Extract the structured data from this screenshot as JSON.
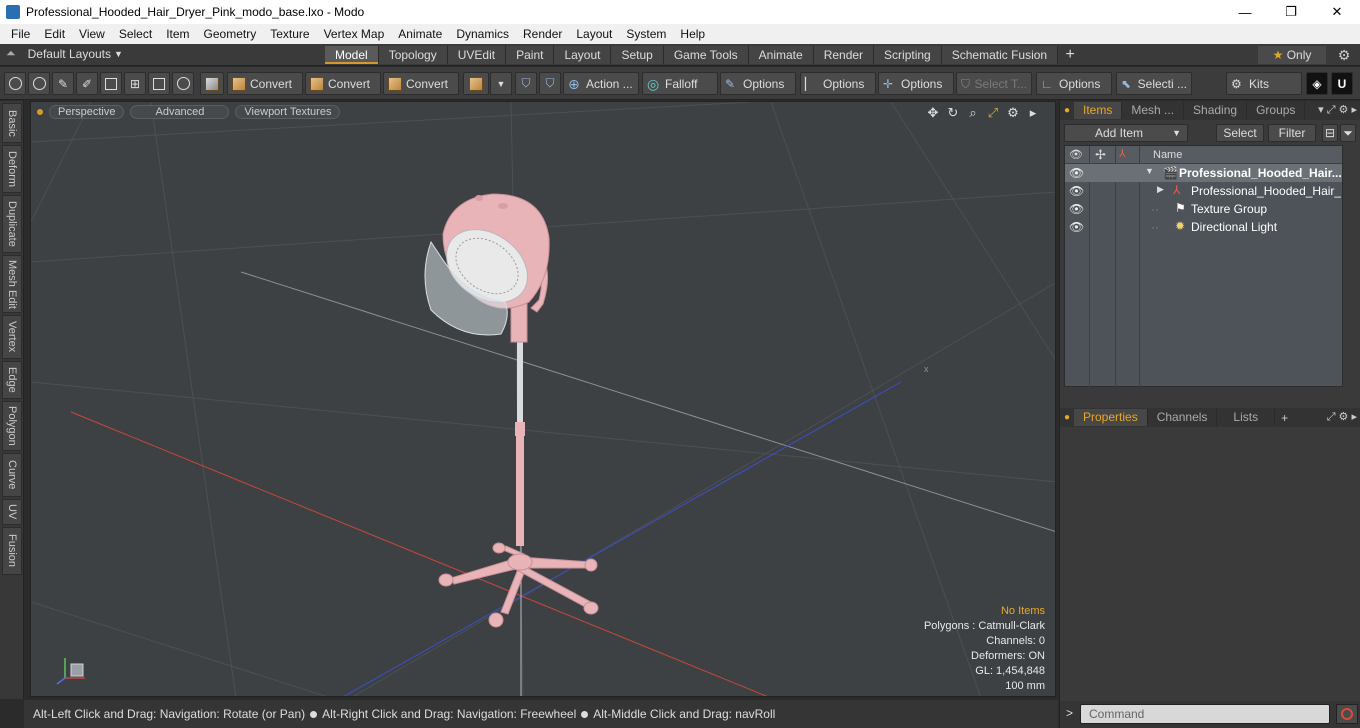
{
  "window": {
    "title": "Professional_Hooded_Hair_Dryer_Pink_modo_base.lxo - Modo",
    "controls": [
      "—",
      "❐",
      "✕"
    ]
  },
  "menu": [
    "File",
    "Edit",
    "View",
    "Select",
    "Item",
    "Geometry",
    "Texture",
    "Vertex Map",
    "Animate",
    "Dynamics",
    "Render",
    "Layout",
    "System",
    "Help"
  ],
  "layouts": {
    "label": "Default Layouts"
  },
  "tabs": [
    "Model",
    "Topology",
    "UVEdit",
    "Paint",
    "Layout",
    "Setup",
    "Game Tools",
    "Animate",
    "Render",
    "Scripting",
    "Schematic Fusion"
  ],
  "active_tab": "Model",
  "only_label": "Only",
  "toolbar": {
    "convert1": "Convert",
    "convert2": "Convert",
    "convert3": "Convert",
    "action": "Action ...",
    "falloff": "Falloff",
    "options1": "Options",
    "options2": "Options",
    "options3": "Options",
    "select_t": "Select T...",
    "options4": "Options",
    "selecti": "Selecti ...",
    "kits": "Kits"
  },
  "left_tabs": [
    "Basic",
    "Deform",
    "Duplicate",
    "Mesh Edit",
    "Vertex",
    "Edge",
    "Polygon",
    "Curve",
    "UV",
    "Fusion"
  ],
  "viewport": {
    "buttons": [
      "Perspective",
      "Advanced",
      "Viewport Textures"
    ],
    "info": {
      "selection": "No Items",
      "polygons": "Polygons : Catmull-Clark",
      "channels": "Channels: 0",
      "deformers": "Deformers: ON",
      "gl": "GL: 1,454,848",
      "scale": "100 mm"
    },
    "colors": {
      "background": "#3d4144",
      "model": "#e8b4b8",
      "x_axis": "#c8463c",
      "z_axis": "#3c4fc8"
    }
  },
  "status": {
    "hint1": "Alt-Left Click and Drag: Navigation: Rotate (or Pan)",
    "hint2": "Alt-Right Click and Drag: Navigation: Freewheel",
    "hint3": "Alt-Middle Click and Drag: navRoll"
  },
  "items_panel": {
    "tabs": [
      "Items",
      "Mesh ...",
      "Shading",
      "Groups"
    ],
    "add_item": "Add Item",
    "select": "Select",
    "filter": "Filter",
    "column_name": "Name",
    "rows": [
      {
        "label": "Professional_Hooded_Hair...",
        "bold": true
      },
      {
        "label": "Professional_Hooded_Hair_ ..."
      },
      {
        "label": "Texture Group"
      },
      {
        "label": "Directional Light"
      }
    ]
  },
  "properties_panel": {
    "tabs": [
      "Properties",
      "Channels",
      "Lists"
    ]
  },
  "command": {
    "placeholder": "Command",
    "prompt": ">"
  }
}
